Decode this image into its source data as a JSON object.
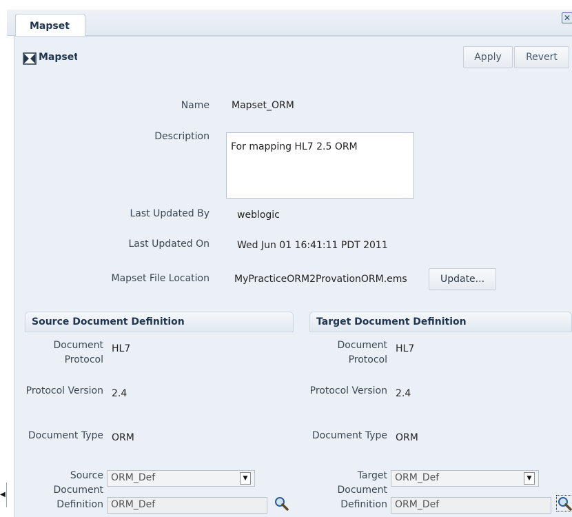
{
  "tab": {
    "label": "Mapset",
    "close": "✕"
  },
  "header": {
    "title": "Mapset",
    "apply": "Apply",
    "revert": "Revert"
  },
  "form": {
    "name_label": "Name",
    "name_value": "Mapset_ORM",
    "description_label": "Description",
    "description_value": "For mapping HL7 2.5 ORM",
    "last_updated_by_label": "Last Updated By",
    "last_updated_by_value": "weblogic",
    "last_updated_on_label": "Last Updated On",
    "last_updated_on_value": "Wed Jun 01 16:41:11 PDT 2011",
    "file_location_label": "Mapset File Location",
    "file_location_value": "MyPracticeORM2ProvationORM.ems",
    "update_button": "Update..."
  },
  "source": {
    "title": "Source Document Definition",
    "protocol_label": "Document Protocol",
    "protocol_value": "HL7",
    "version_label": "Protocol Version",
    "version_value": "2.4",
    "type_label": "Document Type",
    "type_value": "ORM",
    "definition_label": "Source Document Definition",
    "definition_select": "ORM_Def",
    "definition_text": "ORM_Def"
  },
  "target": {
    "title": "Target Document Definition",
    "protocol_label": "Document Protocol",
    "protocol_value": "HL7",
    "version_label": "Protocol Version",
    "version_value": "2.4",
    "type_label": "Document Type",
    "type_value": "ORM",
    "definition_label": "Target Document Definition",
    "definition_select": "ORM_Def",
    "definition_text": "ORM_Def"
  },
  "icons": {
    "mapset": "mapset-icon",
    "search": "search-icon",
    "dropdown": "chevron-down-icon",
    "close": "close-icon",
    "collapse": "chevron-left-icon"
  },
  "colors": {
    "panel_bg": "#eaf0f6",
    "heading": "#1f3550",
    "accent": "#2a6fc1"
  }
}
